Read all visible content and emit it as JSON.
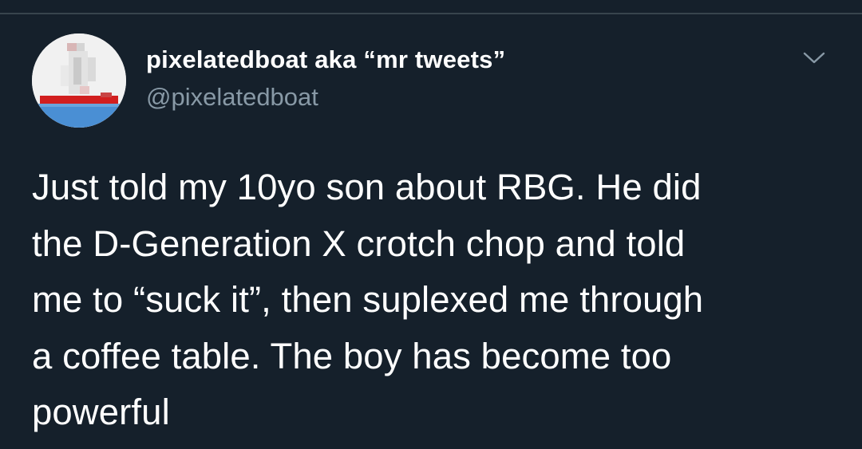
{
  "tweet": {
    "display_name": "pixelatedboat aka “mr tweets”",
    "handle": "@pixelatedboat",
    "text_lines": [
      "Just told my 10yo son about RBG. He did",
      "the D-Generation X crotch chop and told",
      "me to “suck it”, then suplexed me through",
      "a coffee table. The boy has become too",
      "powerful"
    ]
  },
  "icons": {
    "avatar": "pixelated-boat-avatar",
    "menu": "chevron-down-icon"
  },
  "colors": {
    "background": "#15202b",
    "primary_text": "#ffffff",
    "secondary_text": "#8899a6",
    "divider": "#38444d"
  }
}
